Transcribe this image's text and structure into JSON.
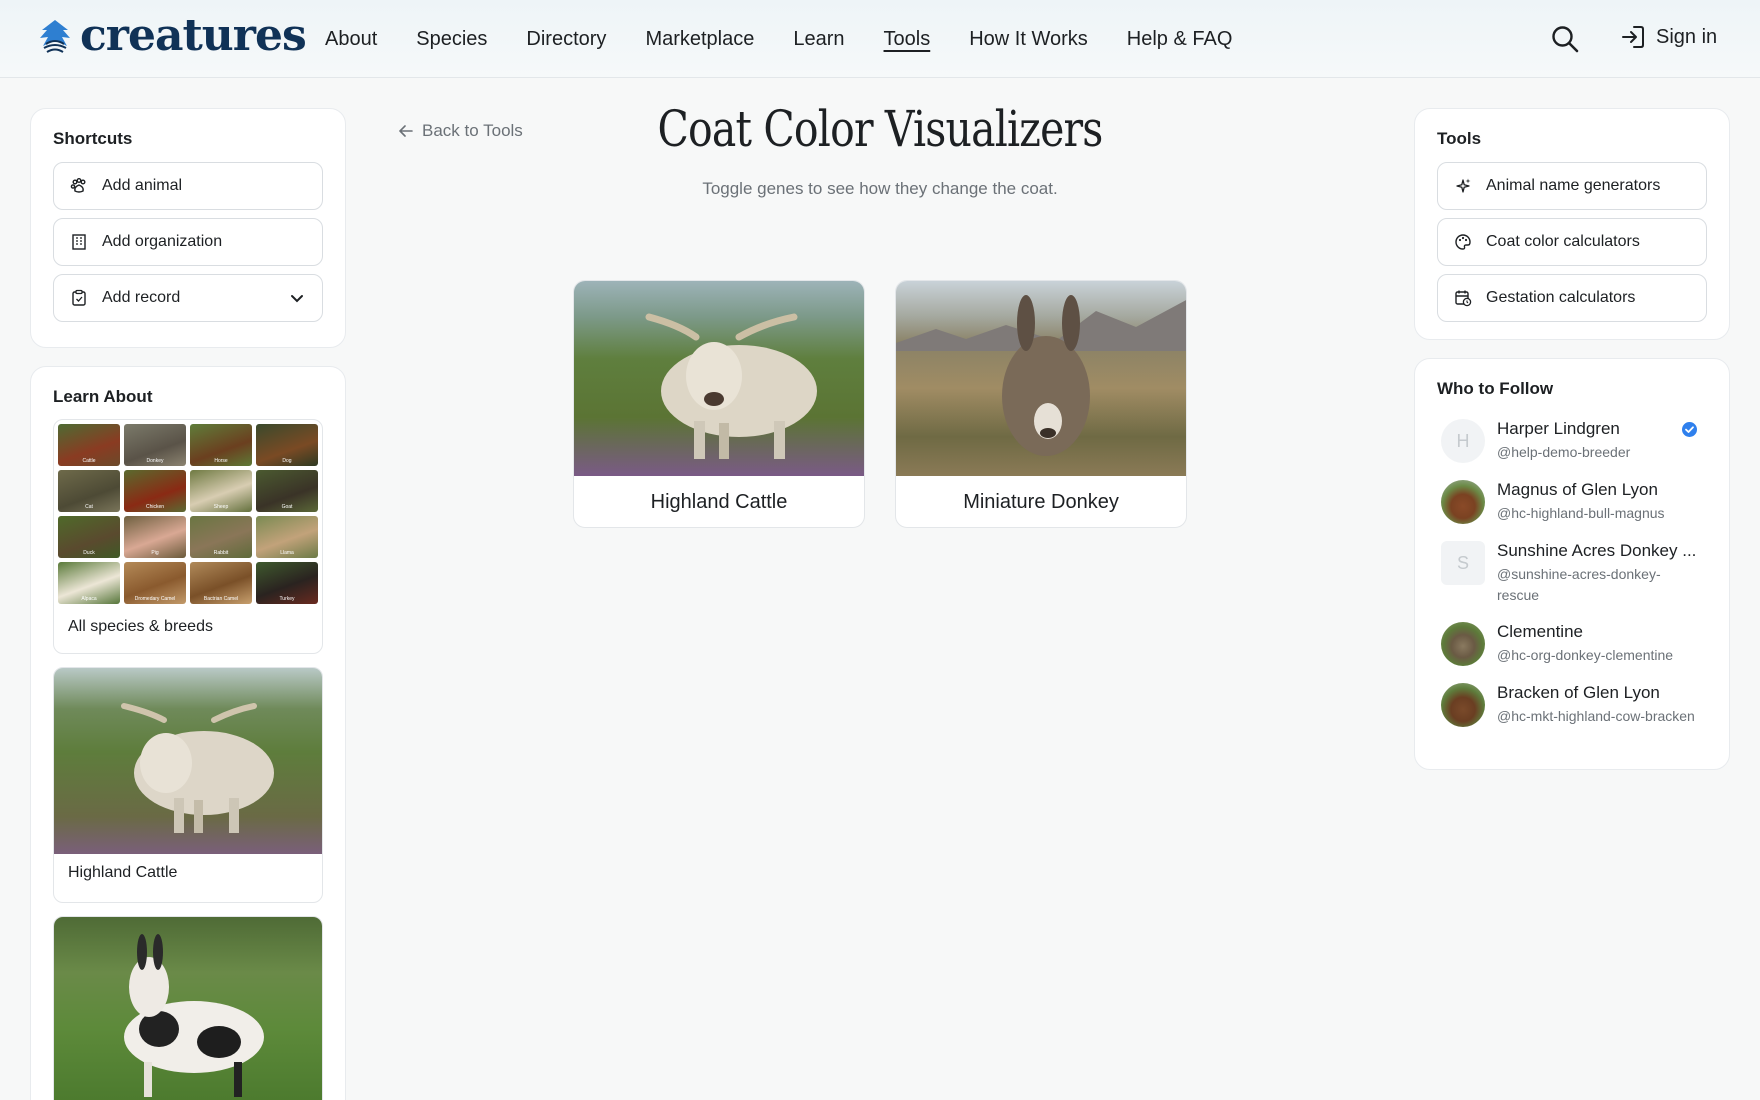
{
  "brand": {
    "name": "creatures"
  },
  "nav": {
    "items": [
      "About",
      "Species",
      "Directory",
      "Marketplace",
      "Learn",
      "Tools",
      "How It Works",
      "Help & FAQ"
    ],
    "active": "Tools",
    "sign_in": "Sign in"
  },
  "shortcuts": {
    "title": "Shortcuts",
    "items": [
      {
        "label": "Add animal",
        "icon": "paw-icon"
      },
      {
        "label": "Add organization",
        "icon": "building-icon"
      },
      {
        "label": "Add record",
        "icon": "clipboard-icon",
        "has_dropdown": true
      }
    ]
  },
  "learn_about": {
    "title": "Learn About",
    "grid_species": [
      "Cattle",
      "Donkey",
      "Horse",
      "Dog",
      "Cat",
      "Chicken",
      "Sheep",
      "Goat",
      "Duck",
      "Pig",
      "Rabbit",
      "Llama",
      "Alpaca",
      "Dromedary Camel",
      "Bactrian Camel",
      "Turkey"
    ],
    "all_label": "All species & breeds",
    "cards": [
      {
        "label": "Highland Cattle"
      },
      {
        "label": ""
      }
    ]
  },
  "main": {
    "back_label": "Back to Tools",
    "title": "Coat Color Visualizers",
    "subtitle": "Toggle genes to see how they change the coat.",
    "visualizers": [
      {
        "label": "Highland Cattle"
      },
      {
        "label": "Miniature Donkey"
      }
    ]
  },
  "tools": {
    "title": "Tools",
    "items": [
      {
        "label": "Animal name generators",
        "icon": "sparkles-icon"
      },
      {
        "label": "Coat color calculators",
        "icon": "palette-icon"
      },
      {
        "label": "Gestation calculators",
        "icon": "calendar-clock-icon"
      }
    ]
  },
  "who_to_follow": {
    "title": "Who to Follow",
    "people": [
      {
        "name": "Harper Lindgren",
        "handle": "@help-demo-breeder",
        "initial": "H",
        "verified": true
      },
      {
        "name": "Magnus of Glen Lyon",
        "handle": "@hc-highland-bull-magnus",
        "initial": "",
        "verified": false
      },
      {
        "name": "Sunshine Acres Donkey ...",
        "handle": "@sunshine-acres-donkey-rescue",
        "initial": "S",
        "verified": false
      },
      {
        "name": "Clementine",
        "handle": "@hc-org-donkey-clementine",
        "initial": "",
        "verified": false
      },
      {
        "name": "Bracken of Glen Lyon",
        "handle": "@hc-mkt-highland-cow-bracken",
        "initial": "",
        "verified": false
      }
    ]
  },
  "colors": {
    "brand": "#103257",
    "verified": "#2f80ed",
    "muted_text": "#6b7177"
  }
}
